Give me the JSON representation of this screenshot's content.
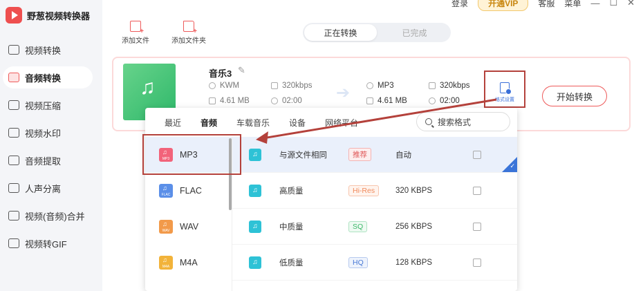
{
  "app": {
    "name": "野葱视频转换器"
  },
  "topbar": {
    "login": "登录",
    "vip": "开通VIP",
    "service": "客服",
    "menu": "菜单",
    "minimize": "—",
    "maximize": "☐",
    "close": "✕"
  },
  "sidebar": {
    "items": [
      {
        "label": "视频转换",
        "icon": "video-convert-icon",
        "active": false
      },
      {
        "label": "音频转换",
        "icon": "audio-convert-icon",
        "active": true
      },
      {
        "label": "视频压缩",
        "icon": "video-compress-icon",
        "active": false
      },
      {
        "label": "视频水印",
        "icon": "video-watermark-icon",
        "active": false
      },
      {
        "label": "音频提取",
        "icon": "audio-extract-icon",
        "active": false
      },
      {
        "label": "人声分离",
        "icon": "voice-separate-icon",
        "active": false
      },
      {
        "label": "视频(音频)合并",
        "icon": "merge-icon",
        "active": false
      },
      {
        "label": "视频转GIF",
        "icon": "gif-icon",
        "active": false
      }
    ]
  },
  "toolbar": {
    "add_file": "添加文件",
    "add_folder": "添加文件夹"
  },
  "tabs": {
    "converting": "正在转换",
    "done": "已完成"
  },
  "task": {
    "filename": "音乐3",
    "src_format": "KWM",
    "src_bitrate": "320kbps",
    "src_size": "4.61 MB",
    "src_duration": "02:00",
    "dst_format": "MP3",
    "dst_bitrate": "320kbps",
    "dst_size": "4.61 MB",
    "dst_duration": "02:00",
    "format_settings": "格式设置",
    "start": "开始转换"
  },
  "popup": {
    "tabs": [
      "最近",
      "音频",
      "车载音乐",
      "设备",
      "网络平台"
    ],
    "active_tab": "音频",
    "search_placeholder": "搜索格式",
    "formats": [
      {
        "label": "MP3",
        "color": "#f2637a"
      },
      {
        "label": "FLAC",
        "color": "#5b8fe8"
      },
      {
        "label": "WAV",
        "color": "#f29a4a"
      },
      {
        "label": "M4A",
        "color": "#f2b33a"
      }
    ],
    "qualities": [
      {
        "name": "与源文件相同",
        "badge": "推荐",
        "badge_color": "#e05b5b",
        "bitrate": "自动"
      },
      {
        "name": "高质量",
        "badge": "Hi-Res",
        "badge_color": "#f08a5c",
        "bitrate": "320 KBPS"
      },
      {
        "name": "中质量",
        "badge": "SQ",
        "badge_color": "#3cb86a",
        "bitrate": "256 KBPS"
      },
      {
        "name": "低质量",
        "badge": "HQ",
        "badge_color": "#4a7ad6",
        "bitrate": "128 KBPS"
      }
    ]
  }
}
